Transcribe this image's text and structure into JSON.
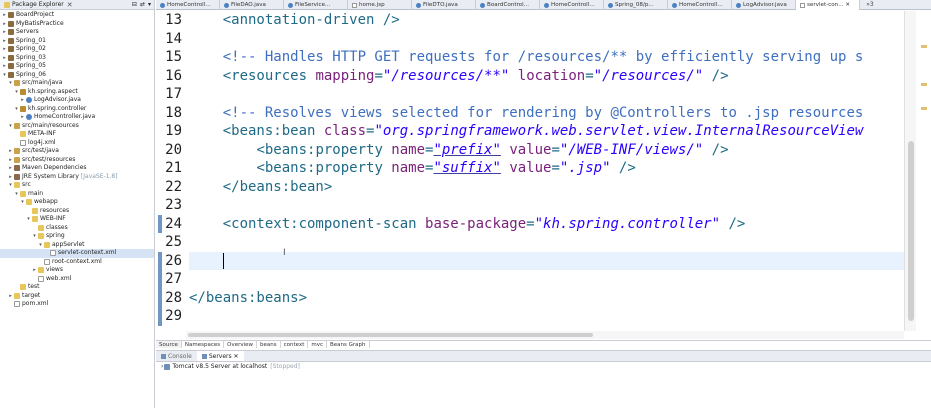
{
  "explorer": {
    "title": "Package Explorer",
    "tree": [
      {
        "label": "BoardProject",
        "icon": "project-icon",
        "arrow": "▸",
        "depth": 0
      },
      {
        "label": "MyBatisPractice",
        "icon": "project-icon",
        "arrow": "▸",
        "depth": 0
      },
      {
        "label": "Servers",
        "icon": "project-icon",
        "arrow": "▸",
        "depth": 0
      },
      {
        "label": "Spring_01",
        "icon": "project-icon",
        "arrow": "▸",
        "depth": 0
      },
      {
        "label": "Spring_02",
        "icon": "project-icon",
        "arrow": "▸",
        "depth": 0
      },
      {
        "label": "Spring_03",
        "icon": "project-icon",
        "arrow": "▸",
        "depth": 0
      },
      {
        "label": "Spring_05",
        "icon": "project-icon",
        "arrow": "▸",
        "depth": 0
      },
      {
        "label": "Spring_06",
        "icon": "project-icon",
        "arrow": "▾",
        "depth": 0
      },
      {
        "label": "src/main/java",
        "icon": "source-folder-icon",
        "arrow": "▾",
        "depth": 1
      },
      {
        "label": "kh.spring.aspect",
        "icon": "package-icon",
        "arrow": "▾",
        "depth": 2
      },
      {
        "label": "LogAdvisor.java",
        "icon": "java-file-icon",
        "arrow": "▸",
        "depth": 3
      },
      {
        "label": "kh.spring.controller",
        "icon": "package-icon",
        "arrow": "▾",
        "depth": 2
      },
      {
        "label": "HomeController.java",
        "icon": "java-file-icon",
        "arrow": "▸",
        "depth": 3
      },
      {
        "label": "src/main/resources",
        "icon": "source-folder-icon",
        "arrow": "▾",
        "depth": 1
      },
      {
        "label": "META-INF",
        "icon": "folder-icon",
        "arrow": "",
        "depth": 2
      },
      {
        "label": "log4j.xml",
        "icon": "xml-file-icon",
        "arrow": "",
        "depth": 2
      },
      {
        "label": "src/test/java",
        "icon": "source-folder-icon",
        "arrow": "▸",
        "depth": 1
      },
      {
        "label": "src/test/resources",
        "icon": "source-folder-icon",
        "arrow": "▸",
        "depth": 1
      },
      {
        "label": "Maven Dependencies",
        "icon": "library-icon",
        "arrow": "▸",
        "depth": 1
      },
      {
        "label": "JRE System Library",
        "note": "[JavaSE-1.8]",
        "icon": "library-icon",
        "arrow": "▸",
        "depth": 1
      },
      {
        "label": "src",
        "icon": "folder-icon",
        "arrow": "▾",
        "depth": 1
      },
      {
        "label": "main",
        "icon": "folder-icon",
        "arrow": "▾",
        "depth": 2
      },
      {
        "label": "webapp",
        "icon": "folder-icon",
        "arrow": "▾",
        "depth": 3
      },
      {
        "label": "resources",
        "icon": "folder-icon",
        "arrow": "",
        "depth": 4
      },
      {
        "label": "WEB-INF",
        "icon": "folder-icon",
        "arrow": "▾",
        "depth": 4
      },
      {
        "label": "classes",
        "icon": "folder-icon",
        "arrow": "",
        "depth": 5
      },
      {
        "label": "spring",
        "icon": "folder-icon",
        "arrow": "▾",
        "depth": 5
      },
      {
        "label": "appServlet",
        "icon": "folder-icon",
        "arrow": "▾",
        "depth": 6
      },
      {
        "label": "servlet-context.xml",
        "icon": "xml-file-icon",
        "arrow": "",
        "depth": 7,
        "selected": true
      },
      {
        "label": "root-context.xml",
        "icon": "xml-file-icon",
        "arrow": "",
        "depth": 6
      },
      {
        "label": "views",
        "icon": "folder-icon",
        "arrow": "▸",
        "depth": 5
      },
      {
        "label": "web.xml",
        "icon": "xml-file-icon",
        "arrow": "",
        "depth": 5
      },
      {
        "label": "test",
        "icon": "folder-icon",
        "arrow": "",
        "depth": 2
      },
      {
        "label": "target",
        "icon": "folder-icon",
        "arrow": "▸",
        "depth": 1
      },
      {
        "label": "pom.xml",
        "icon": "xml-file-icon",
        "arrow": "",
        "depth": 1
      }
    ]
  },
  "editor_tabs": {
    "items": [
      {
        "label": "HomeControll...",
        "type": "java"
      },
      {
        "label": "FileDAO.java",
        "type": "java"
      },
      {
        "label": "FileService...",
        "type": "java"
      },
      {
        "label": "home.jsp",
        "type": "xml"
      },
      {
        "label": "FileDTO.java",
        "type": "java"
      },
      {
        "label": "BoardControl...",
        "type": "java"
      },
      {
        "label": "HomeControll...",
        "type": "java"
      },
      {
        "label": "Spring_08/p...",
        "type": "java"
      },
      {
        "label": "HomeControll...",
        "type": "java"
      },
      {
        "label": "LogAdvisor.java",
        "type": "java"
      },
      {
        "label": "servlet-con... ✕",
        "type": "xml",
        "active": true
      }
    ],
    "overflow": "»3"
  },
  "code": {
    "lines": [
      {
        "n": "13",
        "segs": [
          [
            "tag",
            "<annotation-driven />"
          ]
        ],
        "indent": "    "
      },
      {
        "n": "14",
        "segs": [],
        "indent": ""
      },
      {
        "n": "15",
        "segs": [
          [
            "cmt",
            "<!-- Handles HTTP GET requests for /resources/** by efficiently serving up s"
          ]
        ],
        "indent": "    "
      },
      {
        "n": "16",
        "segs": [
          [
            "tag",
            "<resources "
          ],
          [
            "attr",
            "mapping"
          ],
          [
            "tag",
            "="
          ],
          [
            "str",
            "\"/resources/**\""
          ],
          [
            "tag",
            " "
          ],
          [
            "attr",
            "location"
          ],
          [
            "tag",
            "="
          ],
          [
            "str",
            "\"/resources/\""
          ],
          [
            "tag",
            " />"
          ]
        ],
        "indent": "    "
      },
      {
        "n": "17",
        "segs": [],
        "indent": ""
      },
      {
        "n": "18",
        "segs": [
          [
            "cmt",
            "<!-- Resolves views selected for rendering by @Controllers to .jsp resources"
          ]
        ],
        "indent": "    "
      },
      {
        "n": "19",
        "segs": [
          [
            "tag",
            "<beans:bean "
          ],
          [
            "attr",
            "class"
          ],
          [
            "tag",
            "="
          ],
          [
            "str",
            "\"org.springframework.web.servlet.view.InternalResourceView"
          ]
        ],
        "indent": "    "
      },
      {
        "n": "20",
        "segs": [
          [
            "tag",
            "<beans:property "
          ],
          [
            "attr",
            "name"
          ],
          [
            "tag",
            "="
          ],
          [
            "str-u",
            "\"prefix\""
          ],
          [
            "tag",
            " "
          ],
          [
            "attr",
            "value"
          ],
          [
            "tag",
            "="
          ],
          [
            "str",
            "\"/WEB-INF/views/\""
          ],
          [
            "tag",
            " />"
          ]
        ],
        "indent": "        "
      },
      {
        "n": "21",
        "segs": [
          [
            "tag",
            "<beans:property "
          ],
          [
            "attr",
            "name"
          ],
          [
            "tag",
            "="
          ],
          [
            "str-u",
            "\"suffix\""
          ],
          [
            "tag",
            " "
          ],
          [
            "attr",
            "value"
          ],
          [
            "tag",
            "="
          ],
          [
            "str",
            "\".jsp\""
          ],
          [
            "tag",
            " />"
          ]
        ],
        "indent": "        "
      },
      {
        "n": "22",
        "segs": [
          [
            "tag",
            "</beans:bean>"
          ]
        ],
        "indent": "    "
      },
      {
        "n": "23",
        "segs": [],
        "indent": ""
      },
      {
        "n": "24",
        "segs": [
          [
            "tag",
            "<context:component-scan "
          ],
          [
            "attr",
            "base-package"
          ],
          [
            "tag",
            "="
          ],
          [
            "str",
            "\"kh.spring.controller\""
          ],
          [
            "tag",
            " />"
          ]
        ],
        "indent": "    "
      },
      {
        "n": "25",
        "segs": [],
        "indent": ""
      },
      {
        "n": "26",
        "segs": [],
        "indent": "",
        "current": true
      },
      {
        "n": "27",
        "segs": [],
        "indent": ""
      },
      {
        "n": "28",
        "segs": [
          [
            "tag",
            "</beans:beans>"
          ]
        ],
        "indent": ""
      },
      {
        "n": "29",
        "segs": [],
        "indent": ""
      }
    ]
  },
  "editor_bottom_tabs": {
    "items": [
      "Source",
      "Namespaces",
      "Overview",
      "beans",
      "context",
      "mvc",
      "Beans Graph"
    ],
    "active": 0
  },
  "views": {
    "tabs": [
      {
        "label": "Console",
        "icon": "console-icon",
        "active": false
      },
      {
        "label": "Servers ✕",
        "icon": "servers-icon",
        "active": true
      }
    ],
    "server_row": {
      "arrow": "›",
      "name": "Tomcat v8.5 Server at localhost",
      "status": "[Stopped]"
    }
  },
  "colors": {
    "tag": "#1f6a86",
    "attribute": "#7a1f7a",
    "string": "#2a00ff",
    "comment": "#3f6fbf",
    "current_line": "#e8f2fe",
    "selection": "#d5e3f5"
  }
}
